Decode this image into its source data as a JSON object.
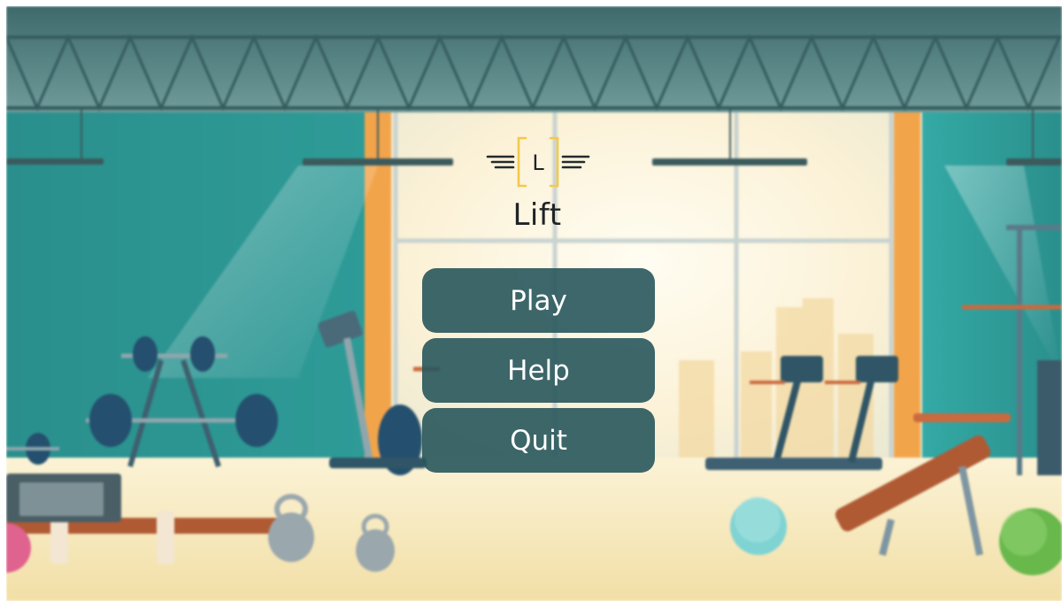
{
  "game": {
    "title": "Lift",
    "logo_letter": "L"
  },
  "menu": {
    "play_label": "Play",
    "help_label": "Help",
    "quit_label": "Quit"
  },
  "colors": {
    "button_bg": "#28565C",
    "button_text": "#FFFFFF",
    "logo_bracket": "#F2C94C",
    "title_text": "#1E2326",
    "wall_teal": "#2E9E9A",
    "floor": "#F6E7B8"
  },
  "icons": {
    "logo": "lift-logo-icon"
  }
}
